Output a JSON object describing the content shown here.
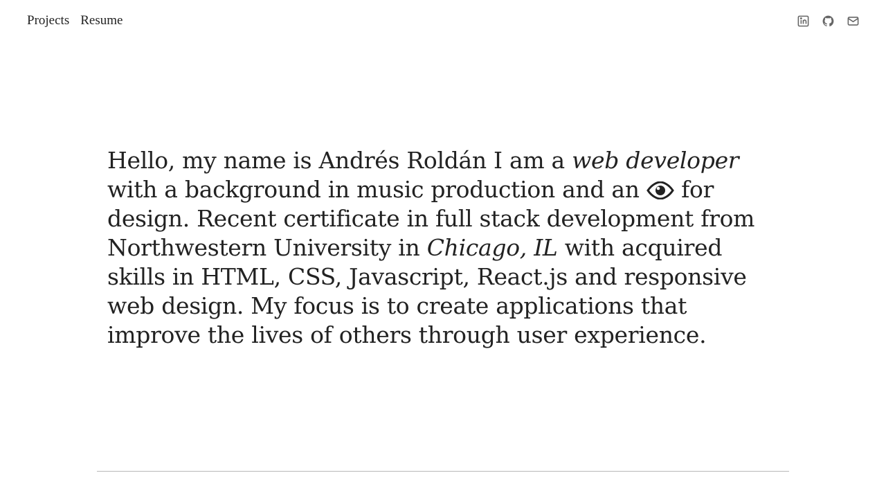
{
  "nav": {
    "links": [
      "Projects",
      "Resume"
    ]
  },
  "social": {
    "icons": [
      "linkedin-icon",
      "github-icon",
      "email-icon"
    ],
    "icon_color": "#666666"
  },
  "intro": {
    "part1": "Hello, my name is Andrés Roldán I am a ",
    "em1": "web developer",
    "part2": " with a background in music production and an ",
    "eye_icon": "eye-icon",
    "part3": " for design. Recent certificate in full stack development from Northwestern University in ",
    "em2": "Chicago, IL",
    "part4": " with acquired skills in HTML, CSS, Javascript, React.js and responsive web design. My focus is to create applications that improve the lives of others through user experience."
  },
  "colors": {
    "text": "#222222",
    "background": "#ffffff",
    "rule": "#b8b8b8"
  }
}
